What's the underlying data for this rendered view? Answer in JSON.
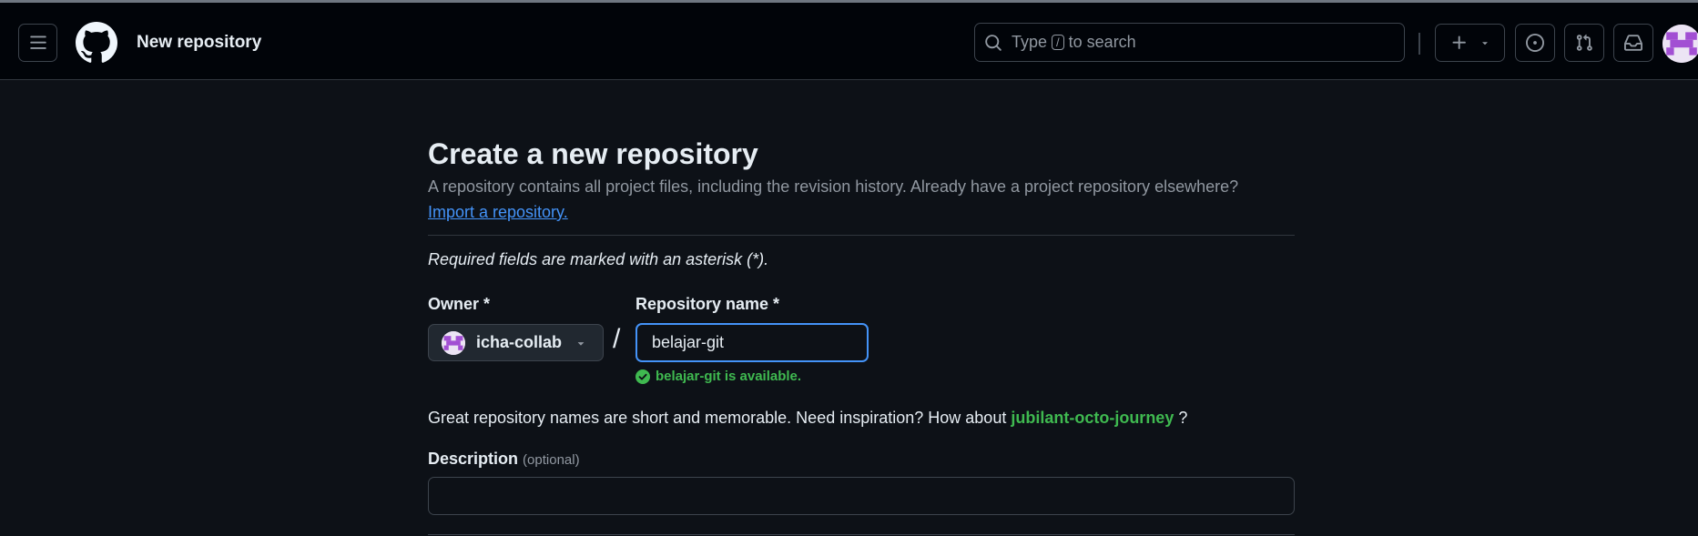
{
  "header": {
    "title": "New repository",
    "search": {
      "prefix": "Type",
      "key": "/",
      "suffix": "to search"
    },
    "icons": [
      "hamburger-menu-icon",
      "github-logo",
      "search-icon",
      "plus-icon",
      "issues-icon",
      "pull-requests-icon",
      "inbox-icon"
    ]
  },
  "main": {
    "heading": "Create a new repository",
    "intro": "A repository contains all project files, including the revision history. Already have a project repository elsewhere?",
    "import_link": "Import a repository.",
    "required_note": "Required fields are marked with an asterisk (*).",
    "owner": {
      "label": "Owner *",
      "value": "icha-collab"
    },
    "separator": "/",
    "repo_name": {
      "label": "Repository name *",
      "value": "belajar-git"
    },
    "availability": "belajar-git is available.",
    "suggestion": {
      "text": "Great repository names are short and memorable. Need inspiration? How about",
      "name": "jubilant-octo-journey",
      "end": "?"
    },
    "description": {
      "label": "Description",
      "optional": "(optional)",
      "value": ""
    }
  },
  "colors": {
    "accent": "#4493f8",
    "success": "#3fb950",
    "background": "#0d1117",
    "header": "#010409"
  }
}
